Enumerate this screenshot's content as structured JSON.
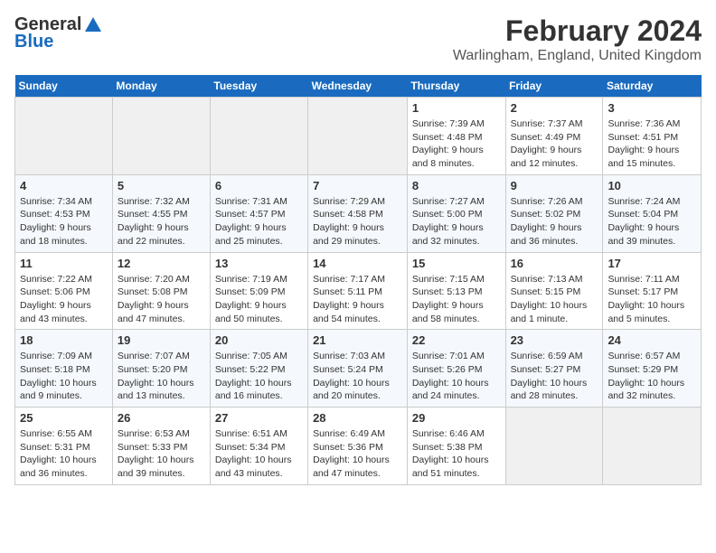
{
  "header": {
    "logo_general": "General",
    "logo_blue": "Blue",
    "title": "February 2024",
    "subtitle": "Warlingham, England, United Kingdom"
  },
  "days_of_week": [
    "Sunday",
    "Monday",
    "Tuesday",
    "Wednesday",
    "Thursday",
    "Friday",
    "Saturday"
  ],
  "weeks": [
    [
      {
        "day": "",
        "detail": ""
      },
      {
        "day": "",
        "detail": ""
      },
      {
        "day": "",
        "detail": ""
      },
      {
        "day": "",
        "detail": ""
      },
      {
        "day": "1",
        "detail": "Sunrise: 7:39 AM\nSunset: 4:48 PM\nDaylight: 9 hours\nand 8 minutes."
      },
      {
        "day": "2",
        "detail": "Sunrise: 7:37 AM\nSunset: 4:49 PM\nDaylight: 9 hours\nand 12 minutes."
      },
      {
        "day": "3",
        "detail": "Sunrise: 7:36 AM\nSunset: 4:51 PM\nDaylight: 9 hours\nand 15 minutes."
      }
    ],
    [
      {
        "day": "4",
        "detail": "Sunrise: 7:34 AM\nSunset: 4:53 PM\nDaylight: 9 hours\nand 18 minutes."
      },
      {
        "day": "5",
        "detail": "Sunrise: 7:32 AM\nSunset: 4:55 PM\nDaylight: 9 hours\nand 22 minutes."
      },
      {
        "day": "6",
        "detail": "Sunrise: 7:31 AM\nSunset: 4:57 PM\nDaylight: 9 hours\nand 25 minutes."
      },
      {
        "day": "7",
        "detail": "Sunrise: 7:29 AM\nSunset: 4:58 PM\nDaylight: 9 hours\nand 29 minutes."
      },
      {
        "day": "8",
        "detail": "Sunrise: 7:27 AM\nSunset: 5:00 PM\nDaylight: 9 hours\nand 32 minutes."
      },
      {
        "day": "9",
        "detail": "Sunrise: 7:26 AM\nSunset: 5:02 PM\nDaylight: 9 hours\nand 36 minutes."
      },
      {
        "day": "10",
        "detail": "Sunrise: 7:24 AM\nSunset: 5:04 PM\nDaylight: 9 hours\nand 39 minutes."
      }
    ],
    [
      {
        "day": "11",
        "detail": "Sunrise: 7:22 AM\nSunset: 5:06 PM\nDaylight: 9 hours\nand 43 minutes."
      },
      {
        "day": "12",
        "detail": "Sunrise: 7:20 AM\nSunset: 5:08 PM\nDaylight: 9 hours\nand 47 minutes."
      },
      {
        "day": "13",
        "detail": "Sunrise: 7:19 AM\nSunset: 5:09 PM\nDaylight: 9 hours\nand 50 minutes."
      },
      {
        "day": "14",
        "detail": "Sunrise: 7:17 AM\nSunset: 5:11 PM\nDaylight: 9 hours\nand 54 minutes."
      },
      {
        "day": "15",
        "detail": "Sunrise: 7:15 AM\nSunset: 5:13 PM\nDaylight: 9 hours\nand 58 minutes."
      },
      {
        "day": "16",
        "detail": "Sunrise: 7:13 AM\nSunset: 5:15 PM\nDaylight: 10 hours\nand 1 minute."
      },
      {
        "day": "17",
        "detail": "Sunrise: 7:11 AM\nSunset: 5:17 PM\nDaylight: 10 hours\nand 5 minutes."
      }
    ],
    [
      {
        "day": "18",
        "detail": "Sunrise: 7:09 AM\nSunset: 5:18 PM\nDaylight: 10 hours\nand 9 minutes."
      },
      {
        "day": "19",
        "detail": "Sunrise: 7:07 AM\nSunset: 5:20 PM\nDaylight: 10 hours\nand 13 minutes."
      },
      {
        "day": "20",
        "detail": "Sunrise: 7:05 AM\nSunset: 5:22 PM\nDaylight: 10 hours\nand 16 minutes."
      },
      {
        "day": "21",
        "detail": "Sunrise: 7:03 AM\nSunset: 5:24 PM\nDaylight: 10 hours\nand 20 minutes."
      },
      {
        "day": "22",
        "detail": "Sunrise: 7:01 AM\nSunset: 5:26 PM\nDaylight: 10 hours\nand 24 minutes."
      },
      {
        "day": "23",
        "detail": "Sunrise: 6:59 AM\nSunset: 5:27 PM\nDaylight: 10 hours\nand 28 minutes."
      },
      {
        "day": "24",
        "detail": "Sunrise: 6:57 AM\nSunset: 5:29 PM\nDaylight: 10 hours\nand 32 minutes."
      }
    ],
    [
      {
        "day": "25",
        "detail": "Sunrise: 6:55 AM\nSunset: 5:31 PM\nDaylight: 10 hours\nand 36 minutes."
      },
      {
        "day": "26",
        "detail": "Sunrise: 6:53 AM\nSunset: 5:33 PM\nDaylight: 10 hours\nand 39 minutes."
      },
      {
        "day": "27",
        "detail": "Sunrise: 6:51 AM\nSunset: 5:34 PM\nDaylight: 10 hours\nand 43 minutes."
      },
      {
        "day": "28",
        "detail": "Sunrise: 6:49 AM\nSunset: 5:36 PM\nDaylight: 10 hours\nand 47 minutes."
      },
      {
        "day": "29",
        "detail": "Sunrise: 6:46 AM\nSunset: 5:38 PM\nDaylight: 10 hours\nand 51 minutes."
      },
      {
        "day": "",
        "detail": ""
      },
      {
        "day": "",
        "detail": ""
      }
    ]
  ]
}
